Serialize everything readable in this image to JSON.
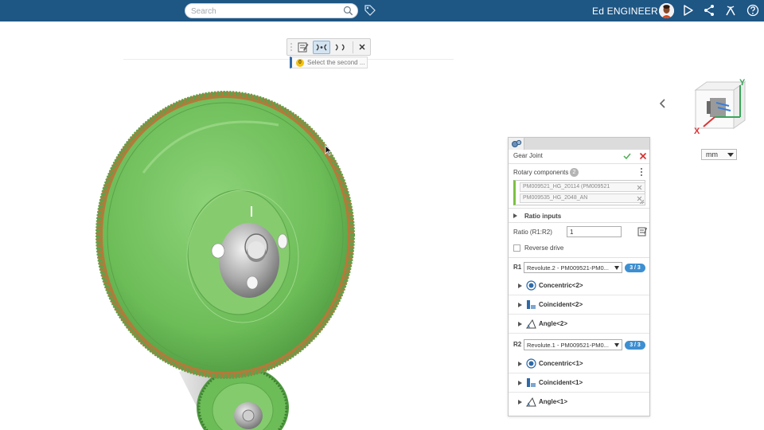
{
  "topbar": {
    "search_placeholder": "Search",
    "user_name": "Ed ENGINEER",
    "icons": [
      "search-icon",
      "tag-icon",
      "avatar",
      "share-play-icon",
      "share-icon",
      "compass-icon",
      "help-icon"
    ]
  },
  "command_bar": {
    "hint_badge": "0",
    "hint_text": "Select the second ..."
  },
  "viewport": {
    "unit": "mm",
    "axis_x": "X",
    "axis_y": "Y"
  },
  "dialog": {
    "title": "Gear Joint",
    "rotary_label": "Rotary components",
    "rotary_count": "2",
    "selections": [
      "PM009521_HG_20114 (PM009521",
      "PM009535_HG_2048_AN"
    ],
    "ratio_inputs_label": "Ratio inputs",
    "ratio_label": "Ratio (R1:R2)",
    "ratio_value": "1",
    "reverse_label": "Reverse drive",
    "r1": {
      "label": "R1",
      "value": "Revolute.2 - PM009521-PM0...",
      "badge": "3 / 3",
      "constraints": [
        "Concentric<2>",
        "Coincident<2>",
        "Angle<2>"
      ]
    },
    "r2": {
      "label": "R2",
      "value": "Revolute.1 - PM009521-PM0...",
      "badge": "3 / 3",
      "constraints": [
        "Concentric<1>",
        "Coincident<1>",
        "Angle<1>"
      ]
    }
  },
  "colors": {
    "topbar": "#1e5684",
    "gear": "#6fbf5a",
    "accent": "#3d8fd1",
    "ok": "#4caf50",
    "cancel": "#d32f2f"
  }
}
